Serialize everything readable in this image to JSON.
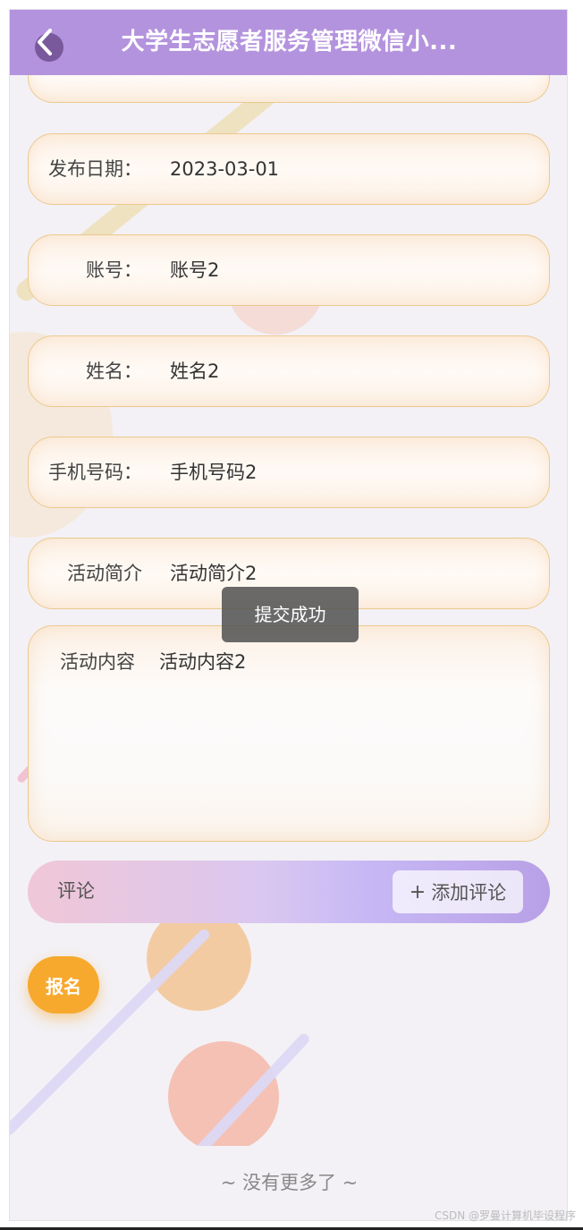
{
  "header": {
    "title": "大学生志愿者服务管理微信小...",
    "back_icon": "chevron-left-icon"
  },
  "fields": [
    {
      "label": "发布日期：",
      "value": "2023-03-01"
    },
    {
      "label": "账号：",
      "value": "账号2"
    },
    {
      "label": "姓名：",
      "value": "姓名2"
    },
    {
      "label": "手机号码：",
      "value": "手机号码2"
    },
    {
      "label": "活动简介",
      "value": "活动简介2"
    }
  ],
  "content": {
    "label": "活动内容",
    "value": "活动内容2"
  },
  "comments": {
    "label": "评论",
    "add_label": "添加评论",
    "add_icon": "plus-icon"
  },
  "signup_label": "报名",
  "toast": "提交成功",
  "footer": {
    "no_more": "~ 没有更多了 ~"
  },
  "watermark": "CSDN @罗曼计算机毕设程序",
  "colors": {
    "header_bg": "#b493de",
    "field_border": "#ecc98f",
    "signup_bg": "#f7a92e"
  }
}
